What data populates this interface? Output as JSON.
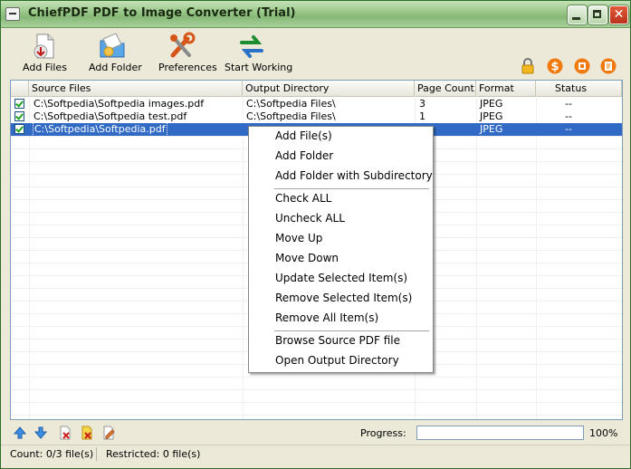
{
  "window": {
    "title": "ChiefPDF PDF to Image Converter (Trial)"
  },
  "toolbar": {
    "add_files": "Add Files",
    "add_folder": "Add Folder",
    "preferences": "Preferences",
    "start_working": "Start Working"
  },
  "columns": [
    "Source Files",
    "Output Directory",
    "Page Count",
    "Format",
    "Status"
  ],
  "rows": [
    {
      "checked": true,
      "source": "C:\\Softpedia\\Softpedia images.pdf",
      "output": "C:\\Softpedia Files\\",
      "pages": "3",
      "format": "JPEG",
      "status": "--"
    },
    {
      "checked": true,
      "source": "C:\\Softpedia\\Softpedia test.pdf",
      "output": "C:\\Softpedia Files\\",
      "pages": "1",
      "format": "JPEG",
      "status": "--"
    },
    {
      "checked": true,
      "source": "C:\\Softpedia\\Softpedia.pdf",
      "output": "",
      "pages": "",
      "format": "JPEG",
      "status": "--",
      "selected": true
    }
  ],
  "context_menu": {
    "group1": [
      "Add File(s)",
      "Add Folder",
      "Add Folder with Subdirectory"
    ],
    "group2": [
      "Check ALL",
      "Uncheck ALL",
      "Move Up",
      "Move Down",
      "Update Selected Item(s)",
      "Remove Selected Item(s)",
      "Remove All Item(s)"
    ],
    "group3": [
      "Browse Source PDF file",
      "Open Output Directory"
    ]
  },
  "progress": {
    "label": "Progress:",
    "percent_text": "100%",
    "value": 0
  },
  "status": {
    "count": "Count:  0/3 file(s)",
    "restricted": "Restricted: 0 file(s)"
  },
  "colors": {
    "title_green": "#9cc98c",
    "selection": "#316ac5",
    "orange_icon": "#f07a0c"
  },
  "icons": [
    "lock-icon",
    "dollar-icon",
    "register-icon",
    "help-icon",
    "arrow-up-icon",
    "arrow-down-icon",
    "delete-icon",
    "delete-all-icon",
    "edit-icon"
  ]
}
